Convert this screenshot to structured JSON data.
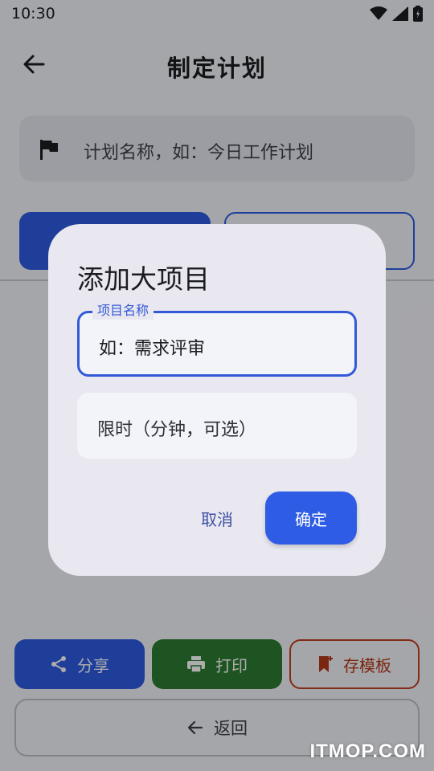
{
  "status_bar": {
    "time": "10:30"
  },
  "app_bar": {
    "title": "制定计划"
  },
  "plan_name": {
    "placeholder": "计划名称，如：今日工作计划"
  },
  "dialog": {
    "title": "添加大项目",
    "name_field": {
      "label": "项目名称",
      "placeholder": "如：需求评审"
    },
    "time_field": {
      "placeholder": "限时（分钟，可选）"
    },
    "cancel_label": "取消",
    "confirm_label": "确定"
  },
  "bottom": {
    "share_label": "分享",
    "print_label": "打印",
    "save_template_label": "存模板",
    "return_label": "返回"
  },
  "watermark": "ITMOP.COM",
  "colors": {
    "primary": "#2f5ce4",
    "print_green": "#2c7d31",
    "save_red": "#c0401f",
    "dialog_bg": "#e9e8f1"
  }
}
